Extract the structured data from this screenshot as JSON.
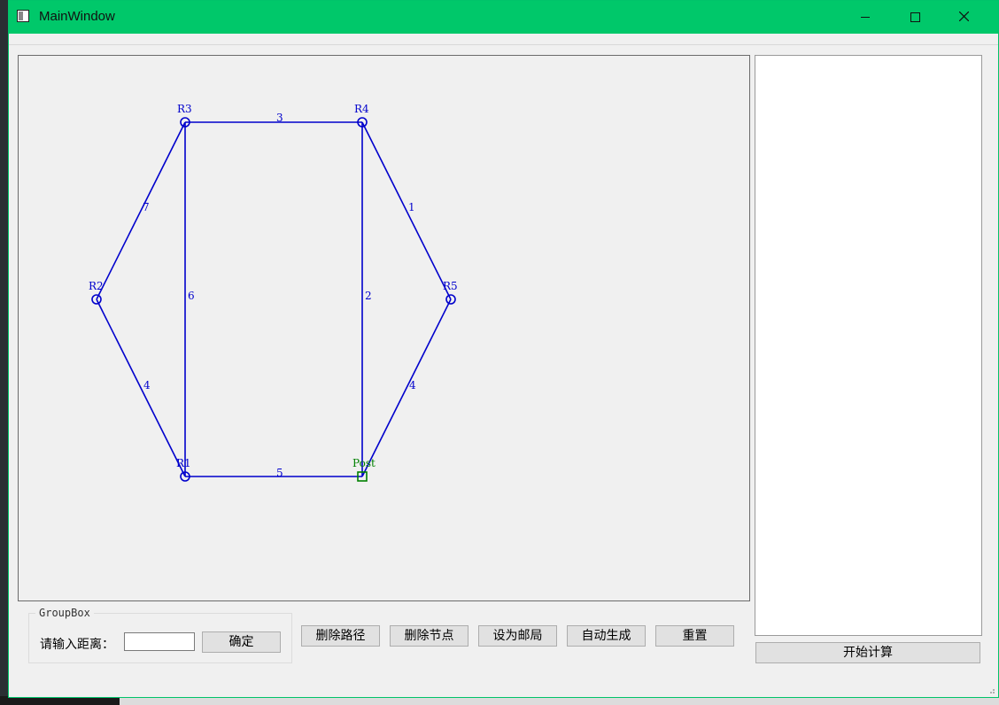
{
  "window": {
    "title": "MainWindow"
  },
  "graph": {
    "edge_color": "#0000cc",
    "post_color": "#008000",
    "nodes": [
      {
        "id": "R1",
        "label": "R1",
        "type": "router"
      },
      {
        "id": "R2",
        "label": "R2",
        "type": "router"
      },
      {
        "id": "R3",
        "label": "R3",
        "type": "router"
      },
      {
        "id": "R4",
        "label": "R4",
        "type": "router"
      },
      {
        "id": "R5",
        "label": "R5",
        "type": "router"
      },
      {
        "id": "Post",
        "label": "Post",
        "type": "post"
      }
    ],
    "edges": [
      {
        "from": "R3",
        "to": "R4",
        "weight": "3"
      },
      {
        "from": "R4",
        "to": "R5",
        "weight": "1"
      },
      {
        "from": "R5",
        "to": "Post",
        "weight": "4"
      },
      {
        "from": "R4",
        "to": "Post",
        "weight": "2"
      },
      {
        "from": "R1",
        "to": "Post",
        "weight": "5"
      },
      {
        "from": "R3",
        "to": "R1",
        "weight": "6"
      },
      {
        "from": "R2",
        "to": "R1",
        "weight": "4"
      },
      {
        "from": "R3",
        "to": "R2",
        "weight": "7"
      }
    ]
  },
  "groupbox": {
    "title": "GroupBox",
    "distance_label": "请输入距离：",
    "distance_value": "",
    "confirm_label": "确定"
  },
  "actions": {
    "delete_path": "删除路径",
    "delete_node": "删除节点",
    "set_post": "设为邮局",
    "auto_generate": "自动生成",
    "reset": "重置"
  },
  "output": {
    "text": "",
    "start_label": "开始计算"
  }
}
